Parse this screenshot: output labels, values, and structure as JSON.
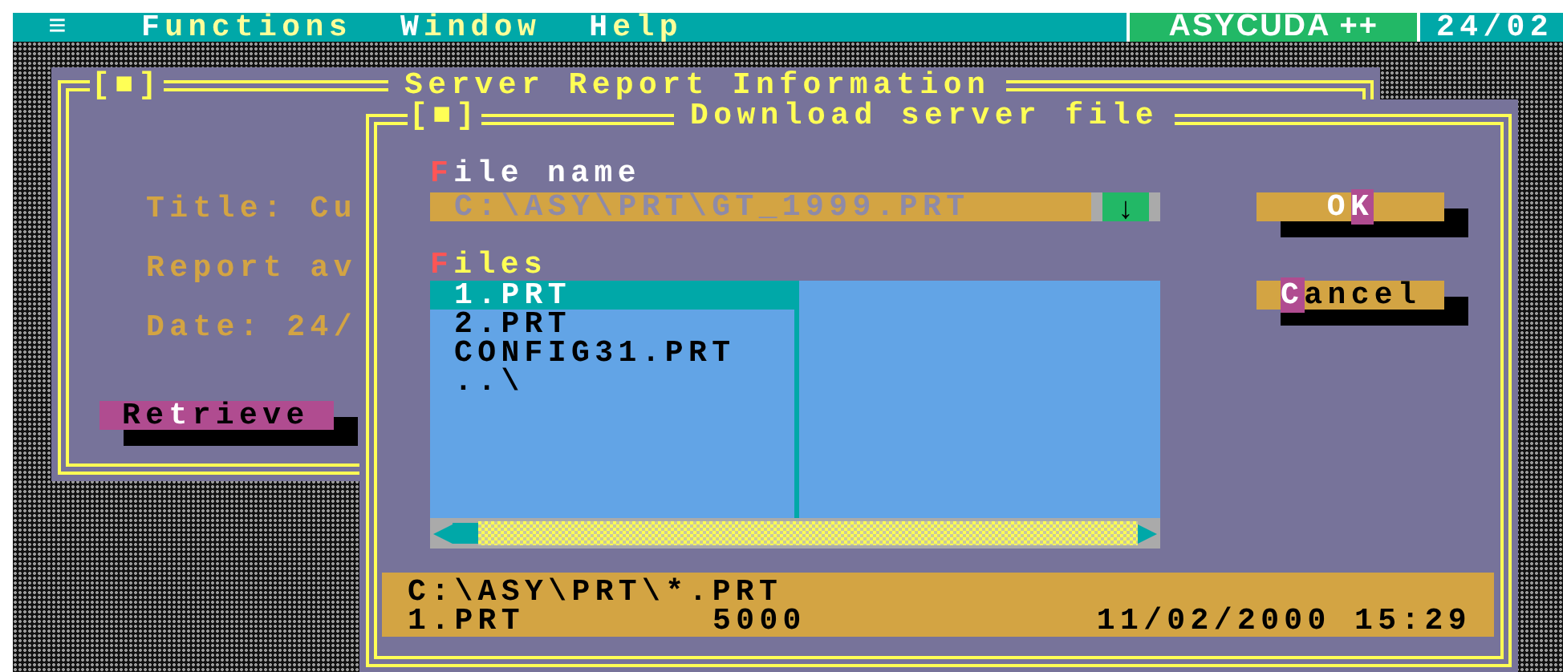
{
  "menu_bar": {
    "menu_icon": "≡",
    "items": [
      {
        "hotkey": "F",
        "rest": "unctions"
      },
      {
        "hotkey": "W",
        "rest": "indow"
      },
      {
        "hotkey": "H",
        "rest": "elp"
      }
    ],
    "app_name": "ASYCUDA ++",
    "date": "24/02"
  },
  "report_window": {
    "close_box": "[■]",
    "title": "Server Report Information",
    "lines": [
      "Title: Cu",
      "Report av",
      "Date: 24/"
    ],
    "retrieve_button": {
      "before": "Re",
      "hotkey": "t",
      "after": "rieve"
    }
  },
  "download_dialog": {
    "close_box": "[■]",
    "title": "Download server file",
    "file_name": {
      "label": {
        "hotkey": "F",
        "rest": "ile name",
        "focused": true
      },
      "value": "C:\\ASY\\PRT\\GT_1999.PRT",
      "dropdown": "↓"
    },
    "files": {
      "label": {
        "hotkey": "F",
        "rest": "iles",
        "focused": false
      },
      "items": [
        {
          "name": "1.PRT",
          "selected": true
        },
        {
          "name": "2.PRT",
          "selected": false
        },
        {
          "name": "CONFIG31.PRT",
          "selected": false
        },
        {
          "name": "..\\",
          "selected": false
        }
      ]
    },
    "buttons": [
      {
        "before": "O",
        "hotkey": "K",
        "default": true
      },
      {
        "hotkey": "C",
        "after": "ancel",
        "default": false
      }
    ],
    "status": {
      "path": "C:\\ASY\\PRT\\*.PRT",
      "file": "1.PRT",
      "size": "5000",
      "modified": "11/02/2000 15:29"
    }
  }
}
